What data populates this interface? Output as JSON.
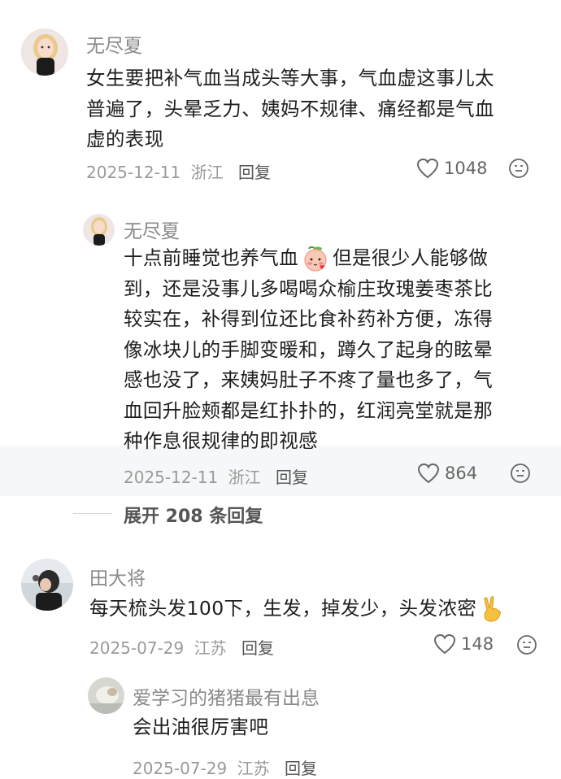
{
  "comments": [
    {
      "name": "无尽夏",
      "text_lines": [
        "女生要把补气血当成头等大事，气血虚这事儿太",
        "普遍了，头晕乏力、姨妈不规律、痛经都是气血",
        "虚的表现"
      ],
      "date": "2025-12-11",
      "location": "浙江",
      "reply_label": "回复",
      "likes": "1048",
      "reply": {
        "name": "无尽夏",
        "text_lines": [
          "十点前睡觉也养气血",
          "但是很少人能够做",
          "到，还是没事儿多喝喝众榆庄玫瑰姜枣茶比",
          "较实在，补得到位还比食补药补方便，冻得",
          "像冰块儿的手脚变暖和，蹲久了起身的眩晕",
          "感也没了，来姨妈肚子不疼了量也多了，气",
          "血回升脸颊都是红扑扑的，红润亮堂就是那",
          "种作息很规律的即视感"
        ],
        "date": "2025-12-11",
        "location": "浙江",
        "reply_label": "回复",
        "likes": "864"
      },
      "expand_label": "展开 208 条回复"
    },
    {
      "name": "田大将",
      "text": "每天梳头发100下，生发，掉发少，头发浓密",
      "date": "2025-07-29",
      "location": "江苏",
      "reply_label": "回复",
      "likes": "148",
      "reply": {
        "name": "爱学习的猪猪最有出息",
        "text": "会出油很厉害吧",
        "date": "2025-07-29",
        "location": "江苏",
        "reply_label": "回复"
      }
    }
  ],
  "icons": {
    "like": "heart-outline-icon",
    "react": "emoji-face-icon",
    "inline_emoji": "peach-blush-emoji",
    "victory": "victory-hand-emoji"
  }
}
